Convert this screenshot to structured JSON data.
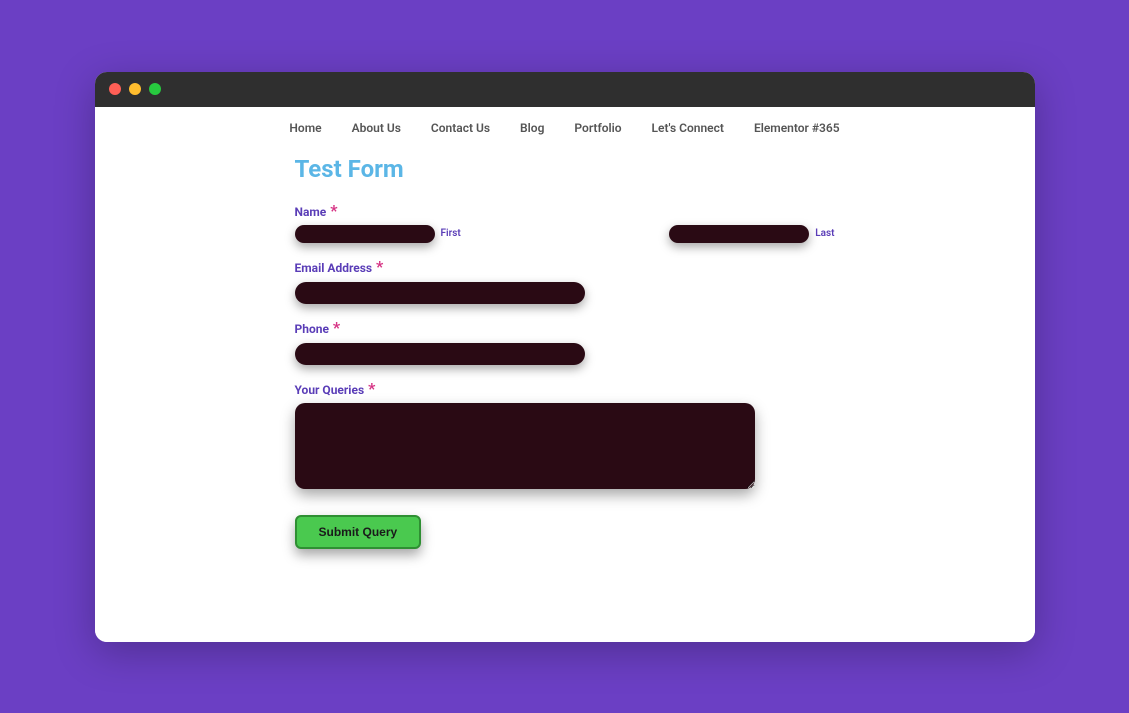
{
  "nav": {
    "items": [
      "Home",
      "About Us",
      "Contact Us",
      "Blog",
      "Portfolio",
      "Let's Connect",
      "Elementor #365"
    ]
  },
  "form": {
    "title": "Test Form",
    "name": {
      "label": "Name",
      "required": "*",
      "first_sub": "First",
      "last_sub": "Last",
      "first_value": "",
      "last_value": ""
    },
    "email": {
      "label": "Email Address",
      "required": "*",
      "value": ""
    },
    "phone": {
      "label": "Phone",
      "required": "*",
      "value": ""
    },
    "queries": {
      "label": "Your Queries",
      "required": "*",
      "value": ""
    },
    "submit_label": "Submit Query"
  }
}
